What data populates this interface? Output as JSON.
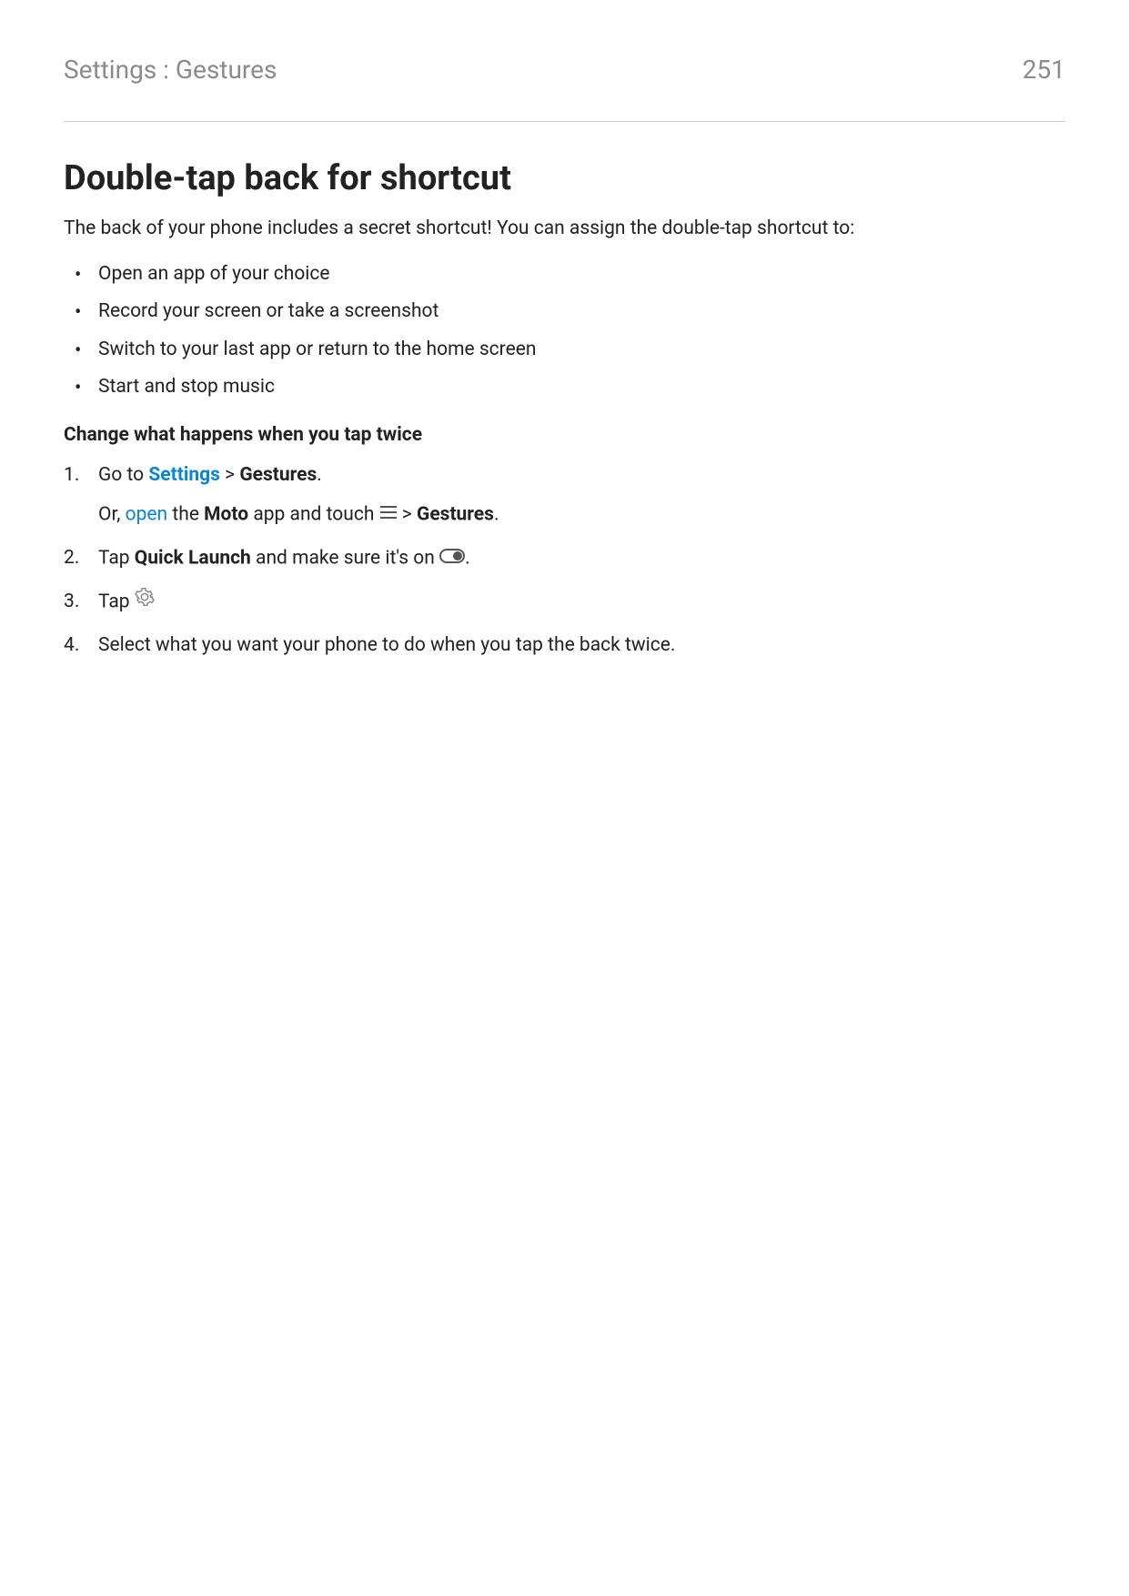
{
  "header": {
    "breadcrumb": "Settings : Gestures",
    "page_number": "251"
  },
  "title": "Double-tap back for shortcut",
  "intro": "The back of your phone includes a secret shortcut! You can assign the double-tap shortcut to:",
  "bullets": [
    "Open an app of your choice",
    "Record your screen or take a screenshot",
    "Switch to your last app or return to the home screen",
    "Start and stop music"
  ],
  "subheading": "Change what happens when you tap twice",
  "steps": {
    "s1": {
      "goto": "Go to ",
      "settings_link": "Settings",
      "gt": " > ",
      "gestures": "Gestures",
      "period": ".",
      "or_prefix": "Or, ",
      "open_link": "open",
      "or_mid1": " the ",
      "moto": "Moto",
      "or_mid2": " app and touch ",
      "gt2": " > ",
      "gestures2": "Gestures",
      "period2": "."
    },
    "s2": {
      "pre": "Tap ",
      "quick_launch": "Quick Launch",
      "post": " and make sure it's on ",
      "period": "."
    },
    "s3": {
      "tap": "Tap "
    },
    "s4": "Select what you want your phone to do when you tap the back twice."
  }
}
